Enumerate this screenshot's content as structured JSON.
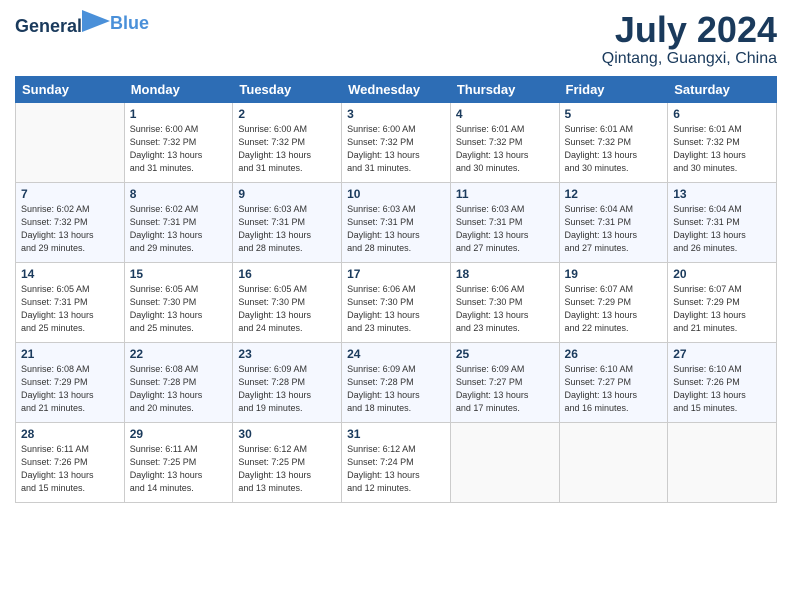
{
  "header": {
    "logo_line1": "General",
    "logo_line2": "Blue",
    "month": "July 2024",
    "location": "Qintang, Guangxi, China"
  },
  "weekdays": [
    "Sunday",
    "Monday",
    "Tuesday",
    "Wednesday",
    "Thursday",
    "Friday",
    "Saturday"
  ],
  "weeks": [
    [
      {
        "day": "",
        "info": ""
      },
      {
        "day": "1",
        "info": "Sunrise: 6:00 AM\nSunset: 7:32 PM\nDaylight: 13 hours\nand 31 minutes."
      },
      {
        "day": "2",
        "info": "Sunrise: 6:00 AM\nSunset: 7:32 PM\nDaylight: 13 hours\nand 31 minutes."
      },
      {
        "day": "3",
        "info": "Sunrise: 6:00 AM\nSunset: 7:32 PM\nDaylight: 13 hours\nand 31 minutes."
      },
      {
        "day": "4",
        "info": "Sunrise: 6:01 AM\nSunset: 7:32 PM\nDaylight: 13 hours\nand 30 minutes."
      },
      {
        "day": "5",
        "info": "Sunrise: 6:01 AM\nSunset: 7:32 PM\nDaylight: 13 hours\nand 30 minutes."
      },
      {
        "day": "6",
        "info": "Sunrise: 6:01 AM\nSunset: 7:32 PM\nDaylight: 13 hours\nand 30 minutes."
      }
    ],
    [
      {
        "day": "7",
        "info": "Sunrise: 6:02 AM\nSunset: 7:32 PM\nDaylight: 13 hours\nand 29 minutes."
      },
      {
        "day": "8",
        "info": "Sunrise: 6:02 AM\nSunset: 7:31 PM\nDaylight: 13 hours\nand 29 minutes."
      },
      {
        "day": "9",
        "info": "Sunrise: 6:03 AM\nSunset: 7:31 PM\nDaylight: 13 hours\nand 28 minutes."
      },
      {
        "day": "10",
        "info": "Sunrise: 6:03 AM\nSunset: 7:31 PM\nDaylight: 13 hours\nand 28 minutes."
      },
      {
        "day": "11",
        "info": "Sunrise: 6:03 AM\nSunset: 7:31 PM\nDaylight: 13 hours\nand 27 minutes."
      },
      {
        "day": "12",
        "info": "Sunrise: 6:04 AM\nSunset: 7:31 PM\nDaylight: 13 hours\nand 27 minutes."
      },
      {
        "day": "13",
        "info": "Sunrise: 6:04 AM\nSunset: 7:31 PM\nDaylight: 13 hours\nand 26 minutes."
      }
    ],
    [
      {
        "day": "14",
        "info": "Sunrise: 6:05 AM\nSunset: 7:31 PM\nDaylight: 13 hours\nand 25 minutes."
      },
      {
        "day": "15",
        "info": "Sunrise: 6:05 AM\nSunset: 7:30 PM\nDaylight: 13 hours\nand 25 minutes."
      },
      {
        "day": "16",
        "info": "Sunrise: 6:05 AM\nSunset: 7:30 PM\nDaylight: 13 hours\nand 24 minutes."
      },
      {
        "day": "17",
        "info": "Sunrise: 6:06 AM\nSunset: 7:30 PM\nDaylight: 13 hours\nand 23 minutes."
      },
      {
        "day": "18",
        "info": "Sunrise: 6:06 AM\nSunset: 7:30 PM\nDaylight: 13 hours\nand 23 minutes."
      },
      {
        "day": "19",
        "info": "Sunrise: 6:07 AM\nSunset: 7:29 PM\nDaylight: 13 hours\nand 22 minutes."
      },
      {
        "day": "20",
        "info": "Sunrise: 6:07 AM\nSunset: 7:29 PM\nDaylight: 13 hours\nand 21 minutes."
      }
    ],
    [
      {
        "day": "21",
        "info": "Sunrise: 6:08 AM\nSunset: 7:29 PM\nDaylight: 13 hours\nand 21 minutes."
      },
      {
        "day": "22",
        "info": "Sunrise: 6:08 AM\nSunset: 7:28 PM\nDaylight: 13 hours\nand 20 minutes."
      },
      {
        "day": "23",
        "info": "Sunrise: 6:09 AM\nSunset: 7:28 PM\nDaylight: 13 hours\nand 19 minutes."
      },
      {
        "day": "24",
        "info": "Sunrise: 6:09 AM\nSunset: 7:28 PM\nDaylight: 13 hours\nand 18 minutes."
      },
      {
        "day": "25",
        "info": "Sunrise: 6:09 AM\nSunset: 7:27 PM\nDaylight: 13 hours\nand 17 minutes."
      },
      {
        "day": "26",
        "info": "Sunrise: 6:10 AM\nSunset: 7:27 PM\nDaylight: 13 hours\nand 16 minutes."
      },
      {
        "day": "27",
        "info": "Sunrise: 6:10 AM\nSunset: 7:26 PM\nDaylight: 13 hours\nand 15 minutes."
      }
    ],
    [
      {
        "day": "28",
        "info": "Sunrise: 6:11 AM\nSunset: 7:26 PM\nDaylight: 13 hours\nand 15 minutes."
      },
      {
        "day": "29",
        "info": "Sunrise: 6:11 AM\nSunset: 7:25 PM\nDaylight: 13 hours\nand 14 minutes."
      },
      {
        "day": "30",
        "info": "Sunrise: 6:12 AM\nSunset: 7:25 PM\nDaylight: 13 hours\nand 13 minutes."
      },
      {
        "day": "31",
        "info": "Sunrise: 6:12 AM\nSunset: 7:24 PM\nDaylight: 13 hours\nand 12 minutes."
      },
      {
        "day": "",
        "info": ""
      },
      {
        "day": "",
        "info": ""
      },
      {
        "day": "",
        "info": ""
      }
    ]
  ]
}
